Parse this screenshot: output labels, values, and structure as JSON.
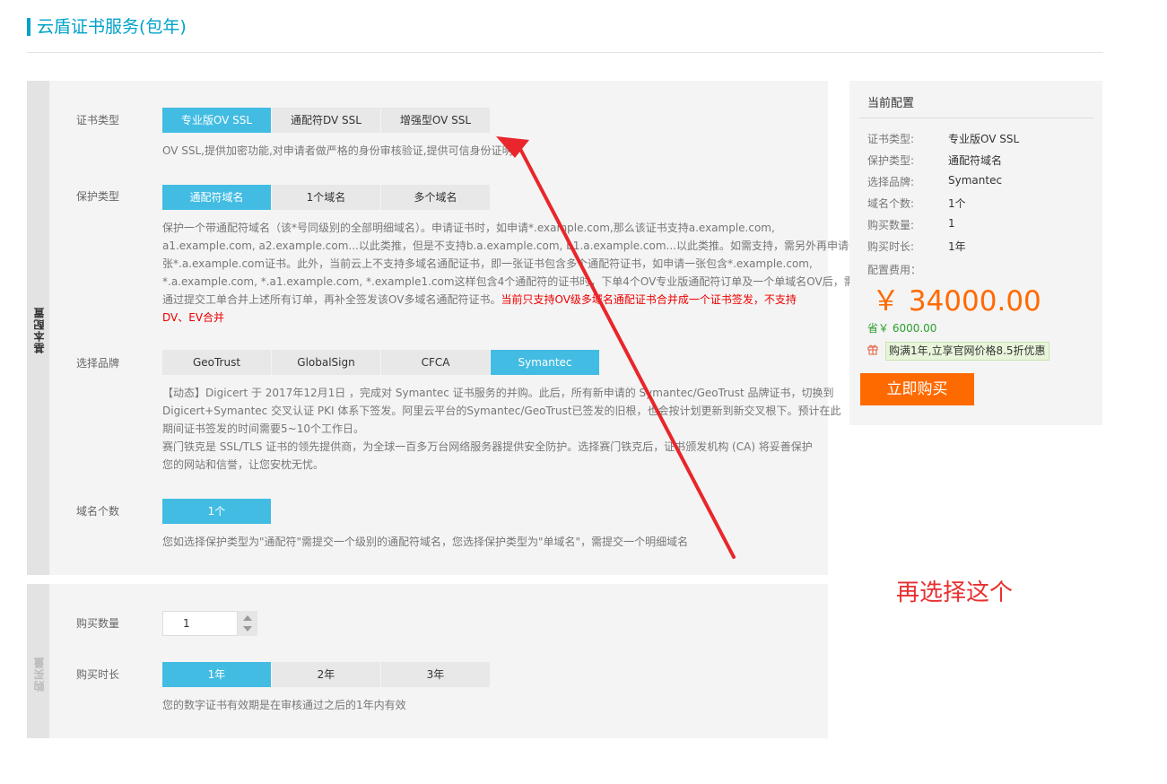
{
  "page_title": "云盾证书服务(包年)",
  "basic": {
    "section_label": "基本配置",
    "cert_type": {
      "label": "证书类型",
      "options": [
        "专业版OV SSL",
        "通配符DV SSL",
        "增强型OV SSL"
      ],
      "selected": "专业版OV SSL",
      "desc": "OV SSL,提供加密功能,对申请者做严格的身份审核验证,提供可信身份证明"
    },
    "protect_type": {
      "label": "保护类型",
      "options": [
        "通配符域名",
        "1个域名",
        "多个域名"
      ],
      "selected": "通配符域名",
      "desc_lines": [
        "保护一个带通配符域名（该*号同级别的全部明细域名）。申请证书时，如申请*.example.com,那么该证书支持a.example.com,",
        "a1.example.com, a2.example.com...以此类推，但是不支持b.a.example.com, b1.a.example.com...以此类推。如需支持，需另外再申请一",
        "张*.a.example.com证书。此外，当前云上不支持多域名通配证书，即一张证书包含多个通配符证书，如申请一张包含*.example.com,",
        "*.a.example.com, *.a1.example.com, *.example1.com这样包含4个通配符的证书时，下单4个OV专业版通配符订单及一个单域名OV后，需",
        "通过提交工单合并上述所有订单，再补全签发该OV多域名通配符证书。"
      ],
      "desc_red_1": "当前只支持OV级多域名通配证书合并成一个证书签发，不支持",
      "desc_red_2": "DV、EV合并"
    },
    "brand": {
      "label": "选择品牌",
      "options": [
        "GeoTrust",
        "GlobalSign",
        "CFCA",
        "Symantec"
      ],
      "selected": "Symantec",
      "desc_lines": [
        "【动态】Digicert 于 2017年12月1日 ，完成对 Symantec 证书服务的并购。此后，所有新申请的 Symantec/GeoTrust 品牌证书，切换到",
        "Digicert+Symantec 交叉认证 PKI 体系下签发。阿里云平台的Symantec/GeoTrust已签发的旧根，也会按计划更新到新交叉根下。预计在此",
        "期间证书签发的时间需要5~10个工作日。",
        "赛门铁克是 SSL/TLS 证书的领先提供商，为全球一百多万台网络服务器提供安全防护。选择赛门铁克后，证书颁发机构 (CA) 将妥善保护",
        "您的网站和信誉，让您安枕无忧。"
      ]
    },
    "domain_count": {
      "label": "域名个数",
      "options": [
        "1个"
      ],
      "selected": "1个",
      "desc": "您如选择保护类型为\"通配符\"需提交一个级别的通配符域名，您选择保护类型为\"单域名\"，需提交一个明细域名"
    }
  },
  "purchase": {
    "section_label": "购买量",
    "quantity": {
      "label": "购买数量",
      "value": "1"
    },
    "duration": {
      "label": "购买时长",
      "options": [
        "1年",
        "2年",
        "3年"
      ],
      "selected": "1年",
      "desc": "您的数字证书有效期是在审核通过之后的1年内有效"
    }
  },
  "summary": {
    "title": "当前配置",
    "rows": [
      {
        "key": "证书类型:",
        "value": "专业版OV SSL"
      },
      {
        "key": "保护类型:",
        "value": "通配符域名"
      },
      {
        "key": "选择品牌:",
        "value": "Symantec"
      },
      {
        "key": "域名个数:",
        "value": "1个"
      },
      {
        "key": "购买数量:",
        "value": "1"
      },
      {
        "key": "购买时长:",
        "value": "1年"
      }
    ],
    "fee_label": "配置费用：",
    "price": "￥ 34000.00",
    "save": "省￥ 6000.00",
    "promo": "购满1年,立享官网价格8.5折优惠",
    "buy_label": "立即购买"
  },
  "annotation": {
    "note": "再选择这个",
    "arrow_color": "#e8262b"
  },
  "colors": {
    "accent": "#00a2ca",
    "selected": "#42bce3",
    "price": "#ff6a00",
    "buy_button": "#ff6a00"
  }
}
